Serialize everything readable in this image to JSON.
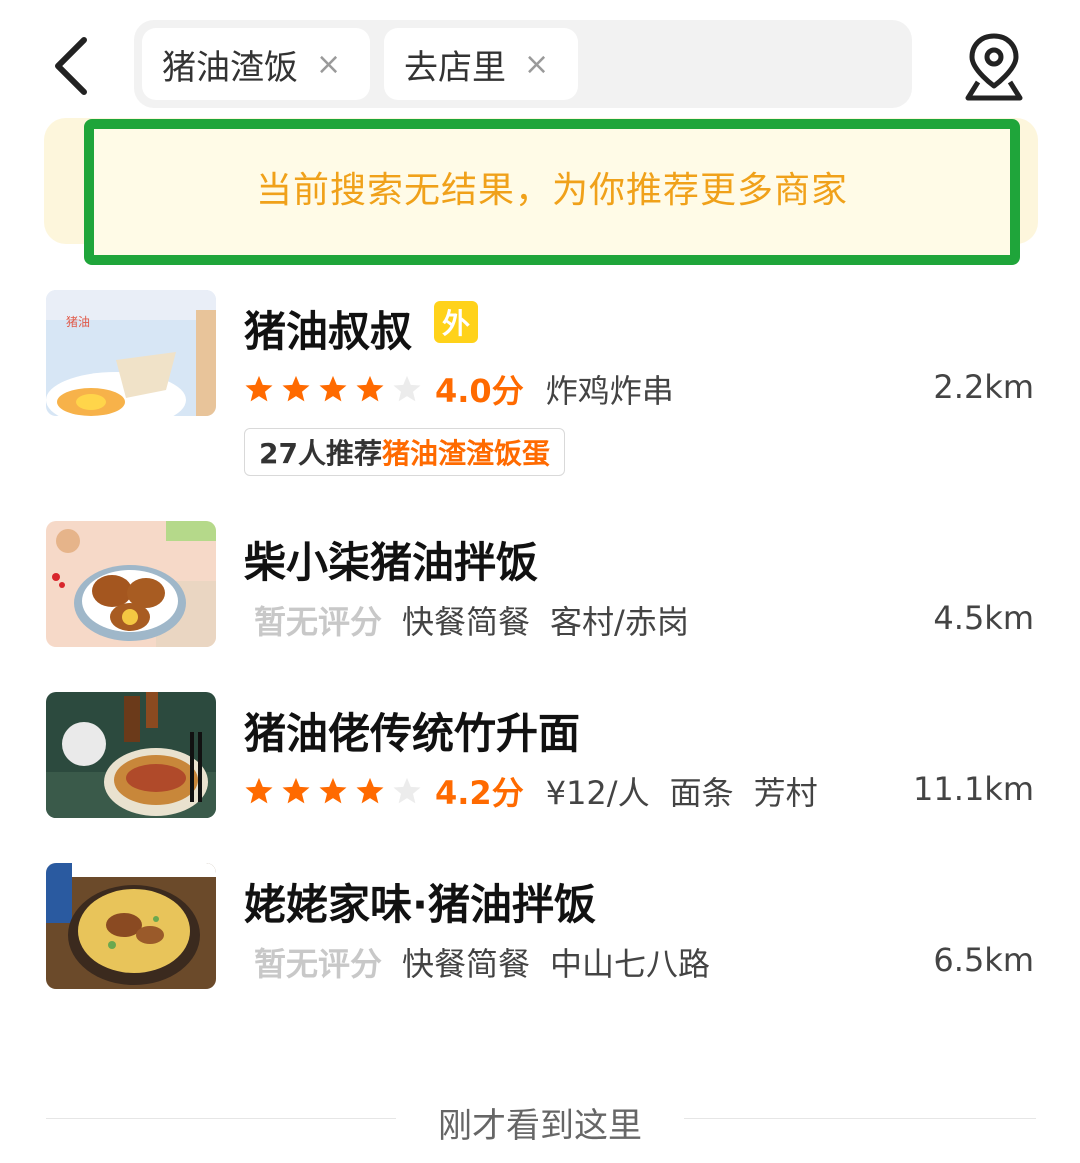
{
  "header": {
    "back_icon": "chevron-left-icon",
    "search_chips": [
      {
        "label": "猪油渣饭",
        "close": "×"
      },
      {
        "label": "去店里",
        "close": "×"
      }
    ],
    "map_icon": "location-pin-icon"
  },
  "banner": {
    "text": "当前搜索无结果，为你推荐更多商家",
    "highlight_color": "#1fa53a"
  },
  "shops": [
    {
      "name": "猪油叔叔",
      "badge": "外",
      "rating": 4.0,
      "score_text": "4.0分",
      "tags": [
        "炸鸡炸串"
      ],
      "distance": "2.2km",
      "recommend_count": "27人推荐",
      "recommend_dish": "猪油渣渣饭蛋"
    },
    {
      "name": "柴小柒猪油拌饭",
      "no_score": "暂无评分",
      "tags": [
        "快餐简餐",
        "客村/赤岗"
      ],
      "distance": "4.5km"
    },
    {
      "name": "猪油佬传统竹升面",
      "rating": 4.2,
      "score_text": "4.2分",
      "tags": [
        "¥12/人",
        "面条",
        "芳村"
      ],
      "distance": "11.1km"
    },
    {
      "name": "姥姥家味·猪油拌饭",
      "no_score": "暂无评分",
      "tags": [
        "快餐简餐",
        "中山七八路"
      ],
      "distance": "6.5km"
    }
  ],
  "footer": {
    "text": "刚才看到这里"
  },
  "colors": {
    "accent_orange": "#ff6a00",
    "banner_text": "#f0a11a",
    "badge_yellow": "#ffd21a"
  }
}
